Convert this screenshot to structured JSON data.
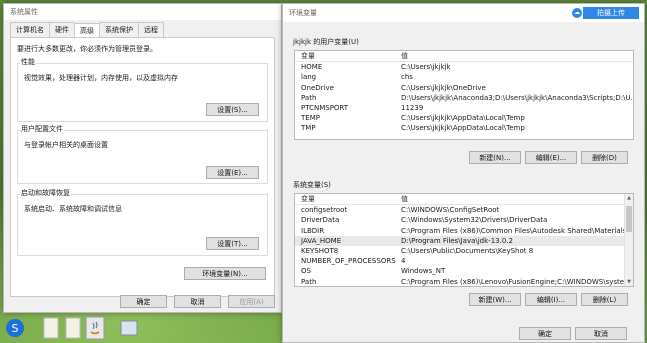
{
  "left_window": {
    "title": "系统属性",
    "tabs": [
      "计算机名",
      "硬件",
      "高级",
      "系统保护",
      "远程"
    ],
    "active_tab": "高级",
    "admin_hint": "要进行大多数更改，你必须作为管理员登录。",
    "performance": {
      "title": "性能",
      "description": "视觉效果，处理器计划，内存使用，以及虚拟内存",
      "button": "设置(S)..."
    },
    "user_profiles": {
      "title": "用户配置文件",
      "description": "与登录帐户相关的桌面设置",
      "button": "设置(E)..."
    },
    "startup": {
      "title": "启动和故障恢复",
      "description": "系统启动、系统故障和调试信息",
      "button": "设置(T)..."
    },
    "env_button": "环境变量(N)...",
    "ok": "确定",
    "cancel": "取消",
    "apply": "应用(A)"
  },
  "right_window": {
    "title": "环境变量",
    "upload_button": "拍摄上传",
    "user_vars": {
      "label": "jkjkjk 的用户变量(U)",
      "col_var": "变量",
      "col_val": "值",
      "rows": [
        {
          "name": "HOME",
          "value": "C:\\Users\\jkjkjk"
        },
        {
          "name": "lang",
          "value": "chs"
        },
        {
          "name": "OneDrive",
          "value": "C:\\Users\\jkjkjk\\OneDrive"
        },
        {
          "name": "Path",
          "value": "D:\\Users\\jkjkjk\\Anaconda3;D:\\Users\\jkjkjk\\Anaconda3\\Scripts;D:\\U..."
        },
        {
          "name": "PTCNMSPORT",
          "value": "11239"
        },
        {
          "name": "TEMP",
          "value": "C:\\Users\\jkjkjk\\AppData\\Local\\Temp"
        },
        {
          "name": "TMP",
          "value": "C:\\Users\\jkjkjk\\AppData\\Local\\Temp"
        }
      ],
      "new": "新建(N)...",
      "edit": "编辑(E)...",
      "delete": "删除(D)"
    },
    "system_vars": {
      "label": "系统变量(S)",
      "col_var": "变量",
      "col_val": "值",
      "rows": [
        {
          "name": "configsetroot",
          "value": "C:\\WINDOWS\\ConfigSetRoot"
        },
        {
          "name": "DriverData",
          "value": "C:\\Windows\\System32\\Drivers\\DriverData"
        },
        {
          "name": "ILBDIR",
          "value": "C:\\Program Files (x86)\\Common Files\\Autodesk Shared\\Materials\\"
        },
        {
          "name": "JAVA_HOME",
          "value": "D:\\Program Files\\Java\\jdk-13.0.2"
        },
        {
          "name": "KEYSHOT8",
          "value": "C:\\Users\\Public\\Documents\\KeyShot 8"
        },
        {
          "name": "NUMBER_OF_PROCESSORS",
          "value": "4"
        },
        {
          "name": "OS",
          "value": "Windows_NT"
        },
        {
          "name": "Path",
          "value": "C:\\Program Files (x86)\\Lenovo\\FusionEngine;C:\\WINDOWS\\system..."
        }
      ],
      "new": "新建(W)...",
      "edit": "编辑(I)...",
      "delete": "删除(L)"
    },
    "ok": "确定",
    "cancel": "取消"
  },
  "taskbar": {
    "icons": [
      "app-icon",
      "file-icon",
      "file-icon",
      "java-icon",
      "window-icon"
    ]
  }
}
